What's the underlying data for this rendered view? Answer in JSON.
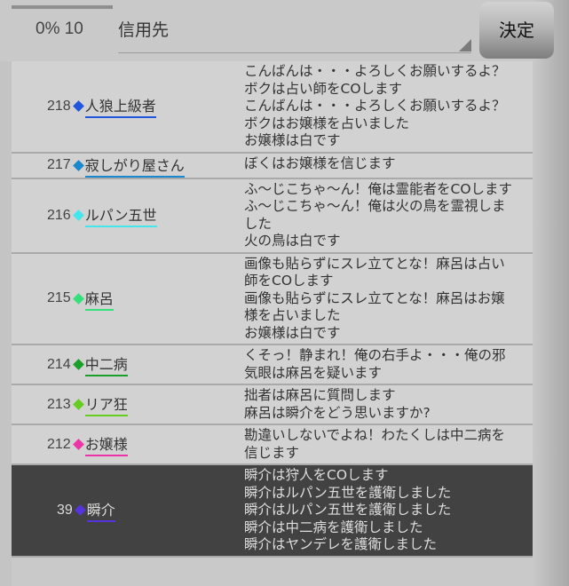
{
  "header": {
    "progress_percent": 0,
    "progress_label": "0% 10",
    "select_label": "信用先",
    "decide_button": "決定"
  },
  "rows": [
    {
      "num": "218",
      "name": "人狼上級者",
      "color": "#2255dd",
      "selected": false,
      "messages": [
        "こんばんは・・・よろしくお願いするよ？",
        "ボクは占い師をCOします",
        "こんばんは・・・よろしくお願いするよ？",
        "ボクはお嬢様を占いました",
        "お嬢様は白です"
      ]
    },
    {
      "num": "217",
      "name": "寂しがり屋さん",
      "color": "#1a88cc",
      "selected": false,
      "messages": [
        "ぼくはお嬢様を信じます"
      ]
    },
    {
      "num": "216",
      "name": "ルパン五世",
      "color": "#44e6ee",
      "selected": false,
      "messages": [
        "ふ～じこちゃ～ん！俺は霊能者をCOします",
        "ふ～じこちゃ～ん！俺は火の鳥を霊視しま",
        "した",
        "火の鳥は白です"
      ]
    },
    {
      "num": "215",
      "name": "麻呂",
      "color": "#33e07a",
      "selected": false,
      "messages": [
        "画像も貼らずにスレ立てとな！麻呂は占い",
        "師をCOします",
        "画像も貼らずにスレ立てとな！麻呂はお嬢",
        "様を占いました",
        "お嬢様は白です"
      ]
    },
    {
      "num": "214",
      "name": "中二病",
      "color": "#1aa02a",
      "selected": false,
      "messages": [
        "くそっ！静まれ！俺の右手よ・・・俺の邪",
        "気眼は麻呂を疑います"
      ]
    },
    {
      "num": "213",
      "name": "リア狂",
      "color": "#66cc22",
      "selected": false,
      "messages": [
        "拙者は麻呂に質問します",
        "麻呂は瞬介をどう思いますか?"
      ]
    },
    {
      "num": "212",
      "name": "お嬢様",
      "color": "#ee33aa",
      "selected": false,
      "messages": [
        "勘違いしないでよね！わたくしは中二病を",
        "信じます"
      ]
    },
    {
      "num": "39",
      "name": "瞬介",
      "color": "#5533dd",
      "selected": true,
      "messages": [
        "瞬介は狩人をCOします",
        "瞬介はルパン五世を護衛しました",
        "瞬介はルパン五世を護衛しました",
        "瞬介は中二病を護衛しました",
        "瞬介はヤンデレを護衛しました"
      ]
    }
  ]
}
